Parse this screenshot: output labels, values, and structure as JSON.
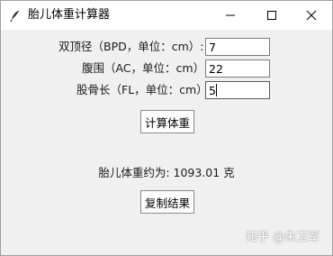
{
  "window": {
    "title": "胎儿体重计算器",
    "icon": "feather-icon",
    "controls": [
      "minimize-icon",
      "maximize-icon",
      "close-icon"
    ]
  },
  "form": {
    "bpd": {
      "label": "双顶径（BPD，单位：cm）:",
      "value": "7"
    },
    "ac": {
      "label": "腹围（AC，单位：cm）:",
      "value": "22"
    },
    "fl": {
      "label": "股骨长（FL，单位：cm）:",
      "value": "5"
    }
  },
  "buttons": {
    "calculate": "计算体重",
    "copy": "复制结果"
  },
  "result": {
    "text": "胎儿体重约为: 1093.01 克"
  },
  "watermark": {
    "text": "知乎 @朱卫军"
  }
}
